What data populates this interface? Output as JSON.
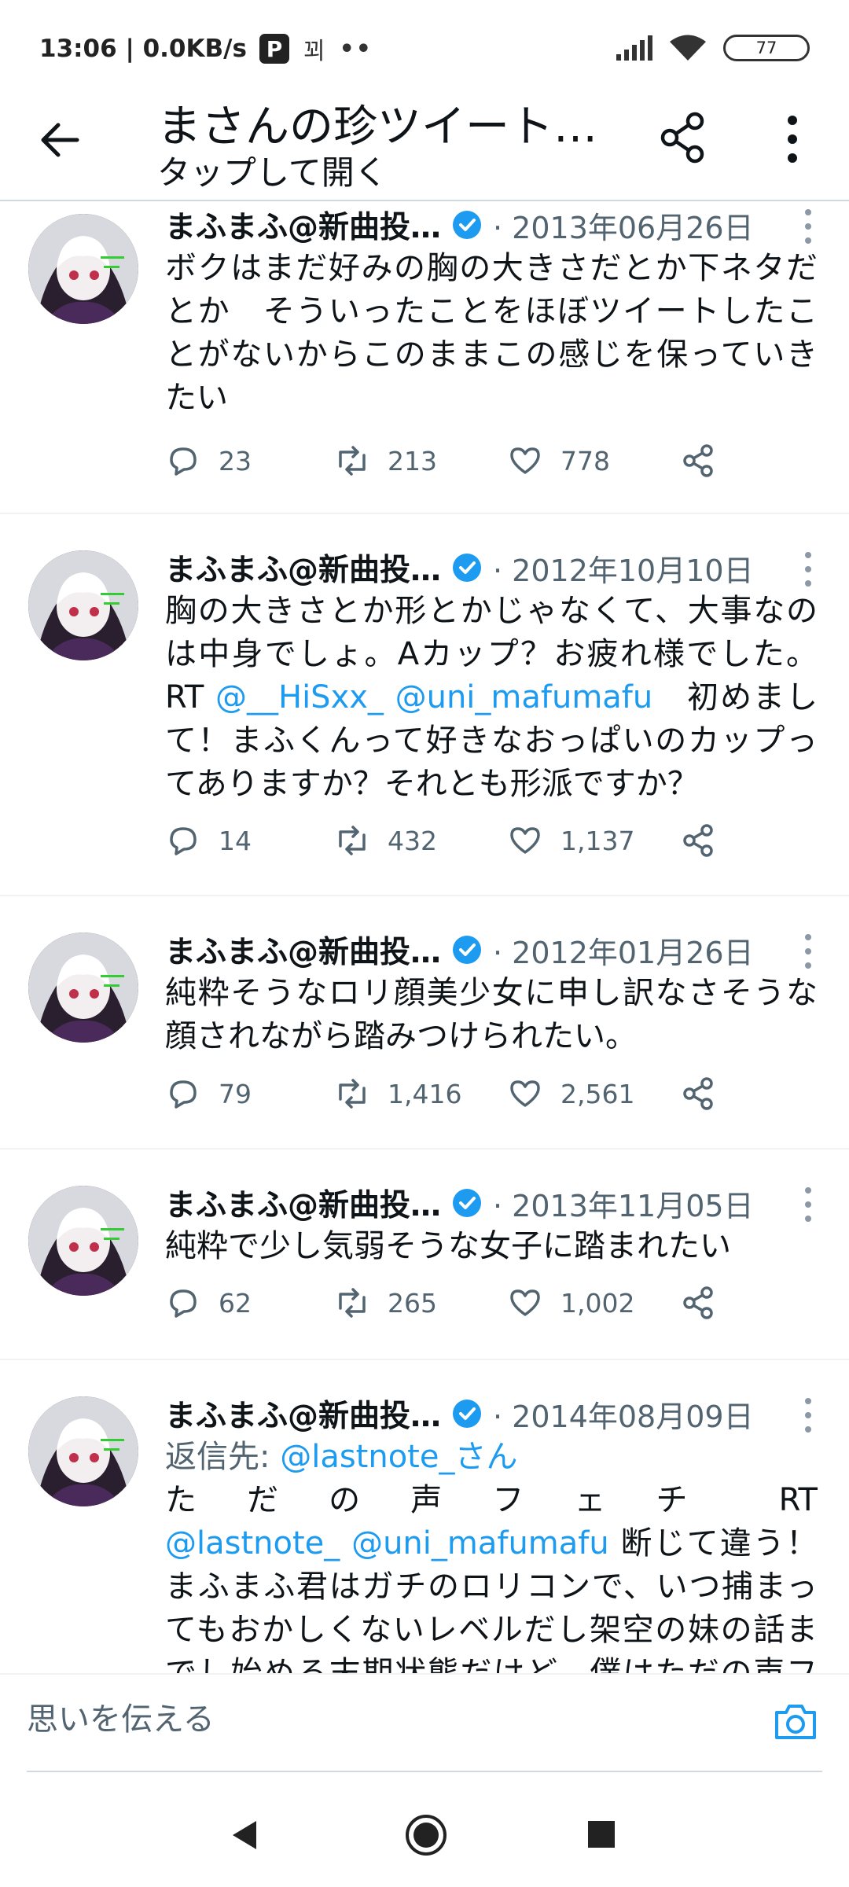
{
  "status_bar": {
    "time": "13:06 | 0.0KB/s",
    "app_icon_p": "P",
    "app_icon_glyph": "꾀",
    "more_dots": "••",
    "battery": "77"
  },
  "header": {
    "title": "まさんの珍ツイート…",
    "subtitle": "タップして開く"
  },
  "tweets": [
    {
      "author": "まふまふ@新曲投…",
      "date": "· 2013年06月26日",
      "body": "ボクはまだ好みの胸の大きさだとか下ネタだとか　そういったことをほぼツイートしたことがないからこのままこの感じを保っていきたい",
      "replies": "23",
      "retweets": "213",
      "likes": "778"
    },
    {
      "author": "まふまふ@新曲投…",
      "date": "· 2012年10月10日",
      "body_pre": "胸の大きさとか形とかじゃなくて、大事なのは中身でしょ。Aカップ？お疲れ様でした。RT ",
      "mention1": "@__HiSxx_",
      "mention2": "@uni_mafumafu",
      "body_post": "　初めまして！まふくんって好きなおっぱいのカップってありますか？それとも形派ですか？",
      "replies": "14",
      "retweets": "432",
      "likes": "1,137"
    },
    {
      "author": "まふまふ@新曲投…",
      "date": "· 2012年01月26日",
      "body": "純粋そうなロリ顔美少女に申し訳なさそうな顔されながら踏みつけられたい。",
      "replies": "79",
      "retweets": "1,416",
      "likes": "2,561"
    },
    {
      "author": "まふまふ@新曲投…",
      "date": "· 2013年11月05日",
      "body": "純粋で少し気弱そうな女子に踏まれたい",
      "replies": "62",
      "retweets": "265",
      "likes": "1,002"
    },
    {
      "author": "まふまふ@新曲投…",
      "date": "· 2014年08月09日",
      "reply_label": "返信先: ",
      "reply_mention": "@lastnote_さん",
      "body_pre": "た　だ　の　声　フ　ェ　チ　　RT ",
      "mention1": "@lastnote_",
      "mention2": "@uni_mafumafu",
      "body_post": " 断じて違う！まふまふ君はガチのロリコンで、いつ捕まってもおかしくないレベルだし架空の妹の話までし始める末期状態だけど、僕はただの声フェチ"
    }
  ],
  "compose": {
    "placeholder": "思いを伝える"
  },
  "colors": {
    "accent": "#1d9bf0",
    "text": "#0f1419",
    "muted": "#536471"
  }
}
